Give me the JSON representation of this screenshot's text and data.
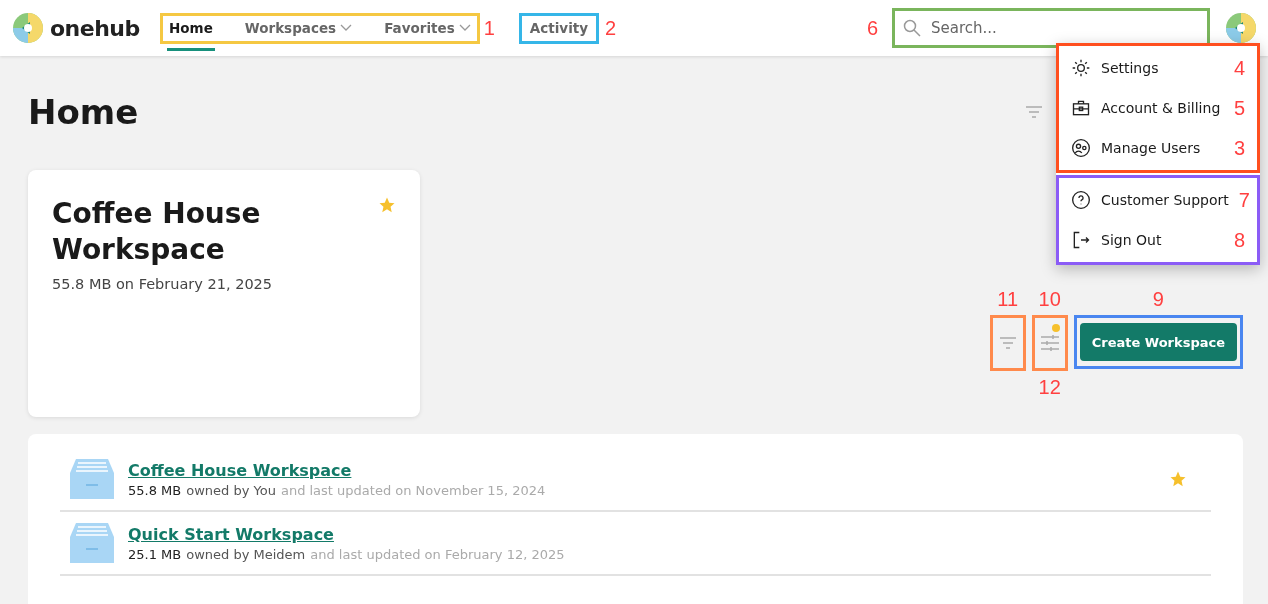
{
  "logo": {
    "wordmark": "onehub"
  },
  "nav": {
    "callout": {
      "number": "1",
      "color": "#f5c842"
    },
    "items": [
      {
        "label": "Home",
        "selected": true,
        "dropdown": false
      },
      {
        "label": "Workspaces",
        "selected": false,
        "dropdown": true
      },
      {
        "label": "Favorites",
        "selected": false,
        "dropdown": true
      }
    ]
  },
  "activity": {
    "label": "Activity",
    "callout": {
      "number": "2",
      "color": "#35b6e8"
    }
  },
  "search": {
    "placeholder": "Search...",
    "callout": {
      "number": "6",
      "color": "#7ab55c"
    }
  },
  "user_menu": {
    "groups": [
      {
        "color": "#ff4f1f",
        "items": [
          {
            "label": "Settings",
            "number": "4"
          },
          {
            "label": "Account & Billing",
            "number": "5"
          },
          {
            "label": "Manage Users",
            "number": "3"
          }
        ]
      },
      {
        "color": "#8b5cf6",
        "items": [
          {
            "label": "Customer Support",
            "number": "7"
          },
          {
            "label": "Sign Out",
            "number": "8"
          }
        ]
      }
    ]
  },
  "page_title": "Home",
  "featured_card": {
    "title": "Coffee House Workspace",
    "subtitle": "55.8 MB on February 21, 2025",
    "favorite": true
  },
  "actions": {
    "sort": {
      "number": "11",
      "color": "#ff8a4c"
    },
    "filter": {
      "number": "10",
      "below_number": "12",
      "color": "#ff8a4c",
      "active": true
    },
    "create": {
      "label": "Create Workspace",
      "number": "9",
      "color": "#4a86f0"
    }
  },
  "workspaces": [
    {
      "name": "Coffee House Workspace",
      "size": "55.8 MB",
      "owner": "owned by You",
      "updated": "and last updated on November 15, 2024",
      "favorite": true
    },
    {
      "name": "Quick Start Workspace",
      "size": "25.1 MB",
      "owner": "owned by Meidem",
      "updated": "and last updated on February 12, 2025",
      "favorite": false
    }
  ]
}
